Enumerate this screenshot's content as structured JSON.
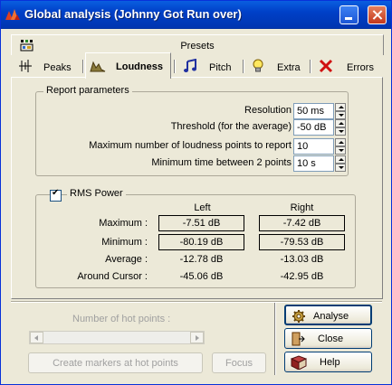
{
  "window": {
    "title": "Global analysis (Johnny Got Run over)",
    "accent": "#0a5fe0"
  },
  "top_tab": {
    "label": "Presets",
    "icon": "presets-icon"
  },
  "tabs": [
    {
      "label": "Peaks",
      "icon": "peaks-icon",
      "active": false
    },
    {
      "label": "Loudness",
      "icon": "loudness-icon",
      "active": true
    },
    {
      "label": "Pitch",
      "icon": "music-notes-icon",
      "active": false
    },
    {
      "label": "Extra",
      "icon": "lightbulb-icon",
      "active": false
    },
    {
      "label": "Errors",
      "icon": "x-icon",
      "active": false
    }
  ],
  "report": {
    "title": "Report parameters",
    "rows": [
      {
        "label": "Resolution",
        "value": "50 ms"
      },
      {
        "label": "Threshold (for the average)",
        "value": "-50 dB"
      },
      {
        "label": "Maximum number of loudness points to report",
        "value": "10"
      },
      {
        "label": "Minimum time between 2 points",
        "value": "10 s"
      }
    ]
  },
  "rms": {
    "title": "RMS Power",
    "checked": true,
    "col_left": "Left",
    "col_right": "Right",
    "rows": [
      {
        "label": "Maximum :",
        "left": "-7.51 dB",
        "right": "-7.42 dB",
        "boxed": true
      },
      {
        "label": "Minimum :",
        "left": "-80.19 dB",
        "right": "-79.53 dB",
        "boxed": true
      },
      {
        "label": "Average :",
        "left": "-12.78 dB",
        "right": "-13.03 dB",
        "boxed": false
      },
      {
        "label": "Around Cursor :",
        "left": "-45.06 dB",
        "right": "-42.95 dB",
        "boxed": false
      }
    ]
  },
  "hot_points": {
    "label": "Number of hot points :",
    "create_label": "Create markers at hot points",
    "focus_label": "Focus"
  },
  "buttons": {
    "analyse": "Analyse",
    "close": "Close",
    "help": "Help"
  }
}
